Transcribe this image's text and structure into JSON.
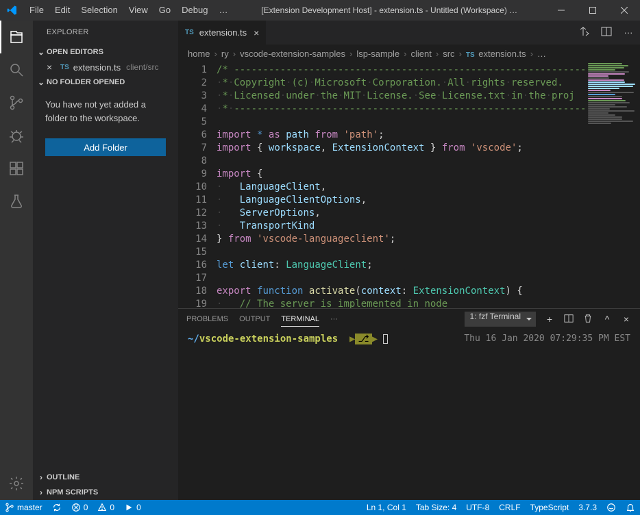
{
  "titlebar": {
    "menus": [
      "File",
      "Edit",
      "Selection",
      "View",
      "Go",
      "Debug",
      "…"
    ],
    "title": "[Extension Development Host] - extension.ts - Untitled (Workspace) …"
  },
  "sidebar": {
    "title": "EXPLORER",
    "openEditors": {
      "label": "OPEN EDITORS",
      "items": [
        {
          "badge": "TS",
          "name": "extension.ts",
          "dir": "client/src"
        }
      ]
    },
    "noFolder": {
      "label": "NO FOLDER OPENED",
      "message": "You have not yet added a folder to the workspace.",
      "button": "Add Folder"
    },
    "outline": "OUTLINE",
    "npm": "NPM SCRIPTS"
  },
  "tabs": {
    "badge": "TS",
    "name": "extension.ts"
  },
  "breadcrumbs": [
    "home",
    "ry",
    "vscode-extension-samples",
    "lsp-sample",
    "client",
    "src"
  ],
  "breadcrumbFile": {
    "badge": "TS",
    "name": "extension.ts"
  },
  "panel": {
    "tabs": [
      "PROBLEMS",
      "OUTPUT",
      "TERMINAL",
      "···"
    ],
    "activeTab": "TERMINAL",
    "terminalName": "1: fzf Terminal",
    "promptHome": "~/",
    "promptDir": "vscode-extension-samples",
    "date": "Thu 16 Jan 2020 07:29:35 PM EST"
  },
  "status": {
    "branch": "master",
    "sync": "",
    "errors": "0",
    "warnings": "0",
    "play": "0",
    "cursor": "Ln 1, Col 1",
    "spaces": "Tab Size: 4",
    "encoding": "UTF-8",
    "eol": "CRLF",
    "lang": "TypeScript",
    "tsver": "3.7.3"
  },
  "code": {
    "lines": [
      {
        "n": 1,
        "html": "<span class='tok-comment'>/*&nbsp;------------------------------------------------------------------------</span>"
      },
      {
        "n": 2,
        "html": "<span class='ws'>·</span><span class='tok-comment'>*</span><span class='ws'>·</span><span class='tok-comment'>Copyright</span><span class='ws'>·</span><span class='tok-comment'>(c)</span><span class='ws'>·</span><span class='tok-comment'>Microsoft</span><span class='ws'>·</span><span class='tok-comment'>Corporation.</span><span class='ws'>·</span><span class='tok-comment'>All</span><span class='ws'>·</span><span class='tok-comment'>rights</span><span class='ws'>·</span><span class='tok-comment'>reserved.</span>"
      },
      {
        "n": 3,
        "html": "<span class='ws'>·</span><span class='tok-comment'>*</span><span class='ws'>·</span><span class='tok-comment'>Licensed</span><span class='ws'>·</span><span class='tok-comment'>under</span><span class='ws'>·</span><span class='tok-comment'>the</span><span class='ws'>·</span><span class='tok-comment'>MIT</span><span class='ws'>·</span><span class='tok-comment'>License.</span><span class='ws'>·</span><span class='tok-comment'>See</span><span class='ws'>·</span><span class='tok-comment'>License.txt</span><span class='ws'>·</span><span class='tok-comment'>in</span><span class='ws'>·</span><span class='tok-comment'>the</span><span class='ws'>·</span><span class='tok-comment'>proj</span>"
      },
      {
        "n": 4,
        "html": "<span class='ws'>·</span><span class='tok-comment'>*</span><span class='ws'>·</span><span class='tok-comment'>---------------------------------------------------------------------</span>"
      },
      {
        "n": 5,
        "html": ""
      },
      {
        "n": 6,
        "html": "<span class='tok-keyword'>import</span> <span class='tok-blue'>*</span> <span class='tok-keyword'>as</span> <span class='tok-var'>path</span> <span class='tok-keyword'>from</span> <span class='tok-string'>'path'</span><span class='tok-pun'>;</span>"
      },
      {
        "n": 7,
        "html": "<span class='tok-keyword'>import</span> <span class='tok-pun'>{</span> <span class='tok-var'>workspace</span><span class='tok-pun'>,</span> <span class='tok-var'>ExtensionContext</span> <span class='tok-pun'>}</span> <span class='tok-keyword'>from</span> <span class='tok-string'>'vscode'</span><span class='tok-pun'>;</span>"
      },
      {
        "n": 8,
        "html": ""
      },
      {
        "n": 9,
        "html": "<span class='tok-keyword'>import</span> <span class='tok-pun'>{</span>"
      },
      {
        "n": 10,
        "html": "<span class='ws'>·</span>   <span class='tok-var'>LanguageClient</span><span class='tok-pun'>,</span>"
      },
      {
        "n": 11,
        "html": "<span class='ws'>·</span>   <span class='tok-var'>LanguageClientOptions</span><span class='tok-pun'>,</span>"
      },
      {
        "n": 12,
        "html": "<span class='ws'>·</span>   <span class='tok-var'>ServerOptions</span><span class='tok-pun'>,</span>"
      },
      {
        "n": 13,
        "html": "<span class='ws'>·</span>   <span class='tok-var'>TransportKind</span>"
      },
      {
        "n": 14,
        "html": "<span class='tok-pun'>}</span> <span class='tok-keyword'>from</span> <span class='tok-string'>'vscode-languageclient'</span><span class='tok-pun'>;</span>"
      },
      {
        "n": 15,
        "html": ""
      },
      {
        "n": 16,
        "html": "<span class='tok-blue'>let</span> <span class='tok-var'>client</span><span class='tok-pun'>:</span> <span class='tok-type'>LanguageClient</span><span class='tok-pun'>;</span>"
      },
      {
        "n": 17,
        "html": ""
      },
      {
        "n": 18,
        "html": "<span class='tok-keyword'>export</span> <span class='tok-blue'>function</span> <span class='tok-func'>activate</span><span class='tok-pun'>(</span><span class='tok-var'>context</span><span class='tok-pun'>:</span> <span class='tok-type'>ExtensionContext</span><span class='tok-pun'>)</span> <span class='tok-pun'>{</span>"
      },
      {
        "n": 19,
        "html": "<span class='ws'>·</span>   <span class='tok-comment'>// The server is implemented in node</span>"
      }
    ]
  }
}
